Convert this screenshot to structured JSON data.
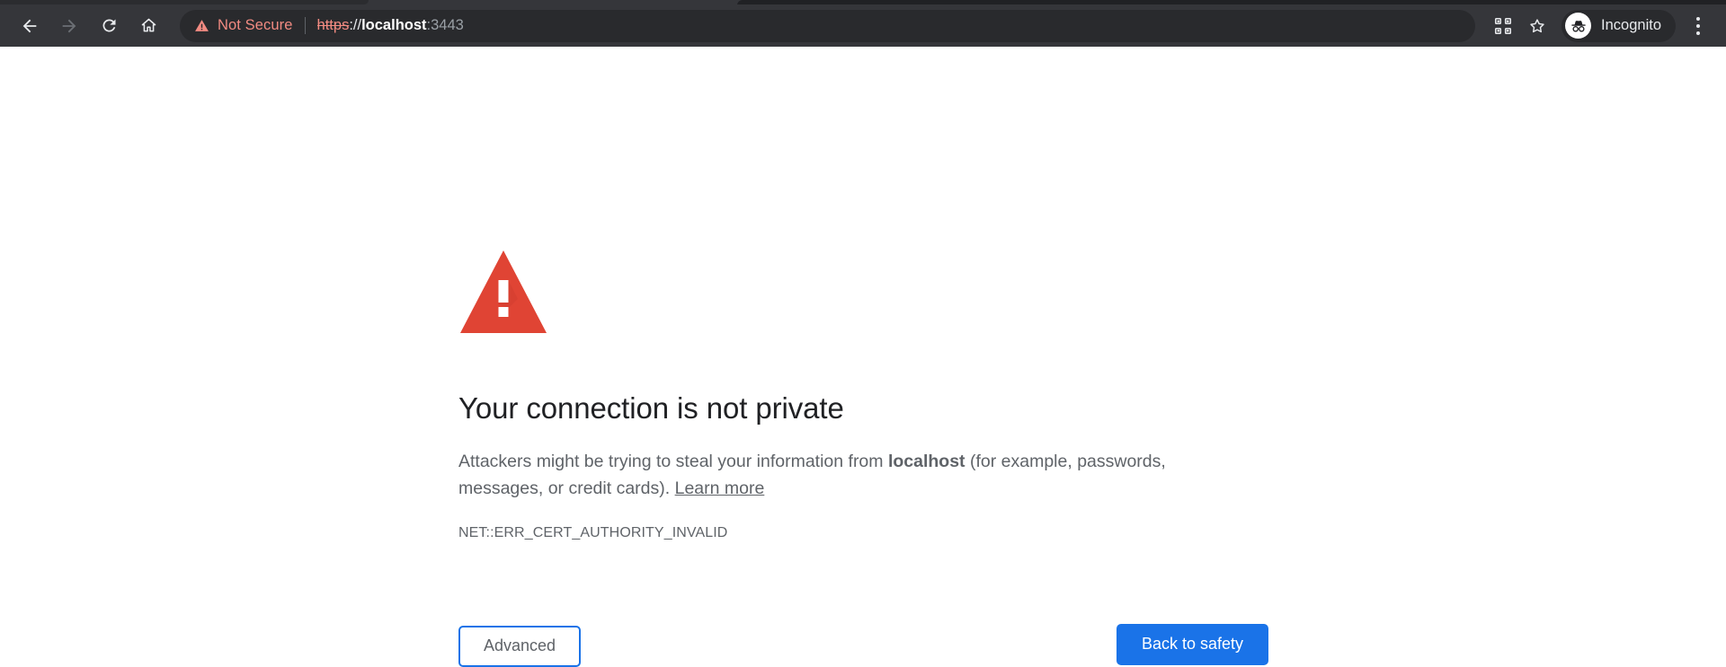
{
  "browser": {
    "nav": {
      "back": {
        "icon": "back-arrow-icon",
        "enabled": "true"
      },
      "forward": {
        "icon": "forward-arrow-icon",
        "enabled": "false"
      },
      "reload": {
        "icon": "reload-icon",
        "enabled": "true"
      },
      "home": {
        "icon": "home-icon",
        "enabled": "true"
      }
    },
    "omnibox": {
      "security_icon": "warning-triangle-icon",
      "security_label": "Not Secure",
      "url_scheme": "https",
      "url_separator": "://",
      "url_host": "localhost",
      "url_port": ":3443",
      "full_url": "https://localhost:3443"
    },
    "actions": {
      "extensions_icon": "extensions-grid-icon",
      "bookmark_icon": "star-icon",
      "profile_icon": "incognito-avatar-icon",
      "profile_label": "Incognito",
      "menu_icon": "three-dot-menu-icon"
    },
    "colors": {
      "chrome_bg": "#35363a",
      "omnibox_bg": "#292a2d",
      "insecure_red": "#f28b82",
      "text_light": "#e8eaed",
      "text_dim": "#9aa0a6"
    }
  },
  "interstitial": {
    "icon": "warning-triangle-icon",
    "icon_color": "#e04434",
    "title": "Your connection is not private",
    "body_prefix": "Attackers might be trying to steal your information from ",
    "body_host": "localhost",
    "body_suffix": " (for example, passwords, messages, or credit cards). ",
    "learn_more_label": "Learn more",
    "error_code": "NET::ERR_CERT_AUTHORITY_INVALID",
    "advanced_label": "Advanced",
    "back_to_safety_label": "Back to safety",
    "colors": {
      "accent_blue": "#1a73e8",
      "title_color": "#202124",
      "body_color": "#5f6368"
    }
  }
}
